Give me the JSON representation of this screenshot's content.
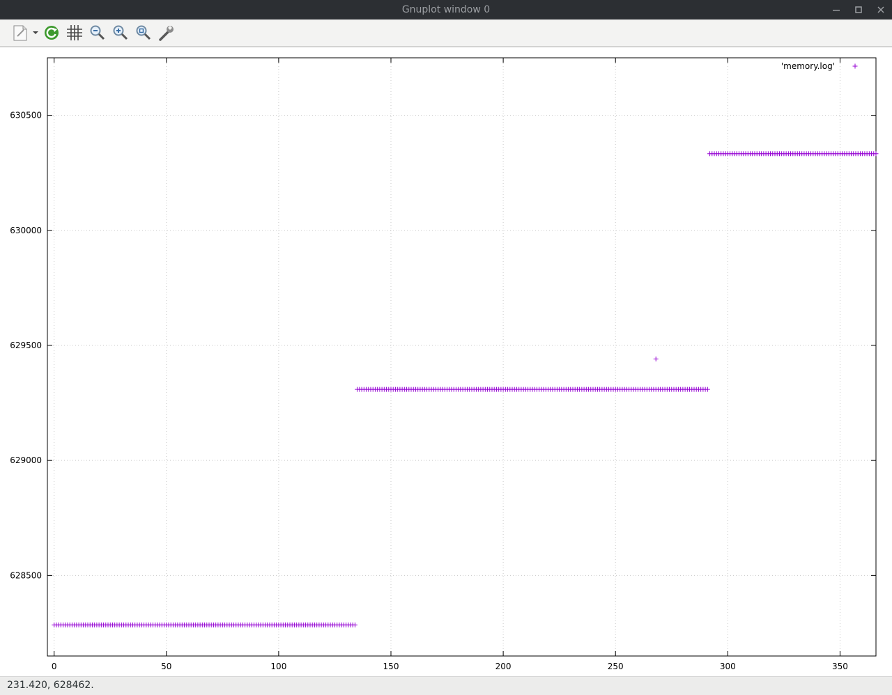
{
  "window": {
    "title": "Gnuplot window 0",
    "controls": [
      "minimize",
      "maximize",
      "close"
    ]
  },
  "toolbar": {
    "buttons": [
      {
        "name": "export-menu",
        "icon": "document-export-icon"
      },
      {
        "name": "replot",
        "icon": "refresh-icon"
      },
      {
        "name": "grid",
        "icon": "grid-icon"
      },
      {
        "name": "zoom-previous",
        "icon": "zoom-out-icon"
      },
      {
        "name": "zoom-next",
        "icon": "zoom-in-icon"
      },
      {
        "name": "autoscale",
        "icon": "zoom-fit-icon"
      },
      {
        "name": "configure",
        "icon": "wrench-icon"
      }
    ]
  },
  "status": {
    "coordinates": "231.420,  628462."
  },
  "chart_data": {
    "type": "scatter",
    "title": "",
    "xlabel": "",
    "ylabel": "",
    "xlim": [
      -3,
      366
    ],
    "ylim": [
      628150,
      630750
    ],
    "xticks": [
      0,
      50,
      100,
      150,
      200,
      250,
      300,
      350
    ],
    "yticks": [
      628500,
      629000,
      629500,
      630000,
      630500
    ],
    "grid": true,
    "legend": "top-right",
    "series": [
      {
        "name": "'memory.log'",
        "color": "#9400d3",
        "marker": "plus",
        "segments": [
          {
            "x_start": 0,
            "x_end": 134,
            "y": 628285
          },
          {
            "x_start": 135,
            "x_end": 291,
            "y": 629309
          },
          {
            "x_start": 292,
            "x_end": 366,
            "y": 630333
          }
        ],
        "points": [
          {
            "x": 268,
            "y": 629441
          }
        ]
      }
    ]
  }
}
